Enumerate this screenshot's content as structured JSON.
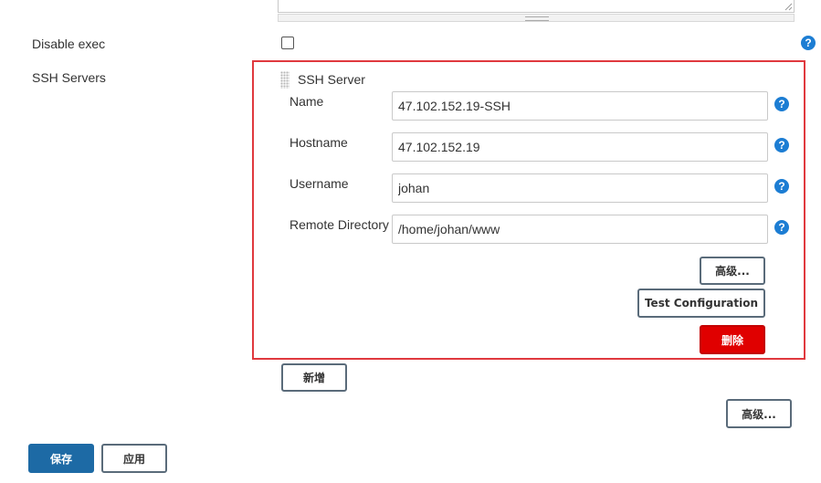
{
  "form": {
    "disable_exec_label": "Disable exec",
    "ssh_servers_label": "SSH Servers"
  },
  "ssh_server": {
    "heading": "SSH Server",
    "name_label": "Name",
    "name_value": "47.102.152.19-SSH",
    "hostname_label": "Hostname",
    "hostname_value": "47.102.152.19",
    "username_label": "Username",
    "username_value": "johan",
    "remote_dir_label": "Remote Directory",
    "remote_dir_value": "/home/johan/www",
    "advanced_label": "高级...",
    "test_label": "Test Configuration",
    "delete_label": "删除",
    "accent_color": "#e0393e"
  },
  "add_label": "新增",
  "outer_advanced_label": "高级...",
  "footer": {
    "save_label": "保存",
    "apply_label": "应用"
  },
  "help_glyph": "?",
  "icons": {
    "help": "question-circle-icon",
    "drag": "drag-handle-icon"
  }
}
